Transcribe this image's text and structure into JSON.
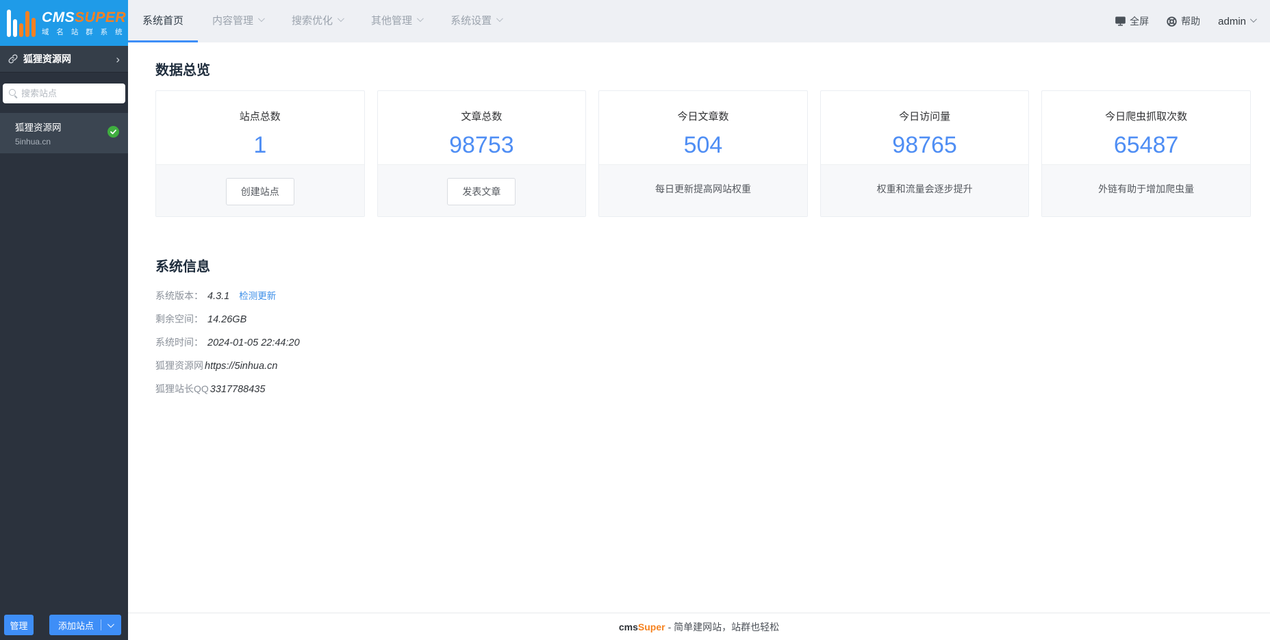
{
  "logo": {
    "brand_cms": "CMS",
    "brand_super": "SUPER",
    "subtitle": "域 名 站 群 系 统"
  },
  "header": {
    "tabs": [
      {
        "label": "系统首页",
        "active": true
      },
      {
        "label": "内容管理",
        "active": false
      },
      {
        "label": "搜索优化",
        "active": false
      },
      {
        "label": "其他管理",
        "active": false
      },
      {
        "label": "系统设置",
        "active": false
      }
    ],
    "actions": {
      "fullscreen": "全屏",
      "help": "帮助",
      "user": "admin"
    }
  },
  "sidebar": {
    "site_group_name": "狐狸资源网",
    "search_placeholder": "搜索站点",
    "sites": [
      {
        "name": "狐狸资源网",
        "domain": "5inhua.cn",
        "active": true
      }
    ],
    "manage_button": "管理",
    "add_site_button": "添加站点"
  },
  "overview": {
    "title": "数据总览",
    "cards": [
      {
        "title": "站点总数",
        "value": "1",
        "action": "创建站点"
      },
      {
        "title": "文章总数",
        "value": "98753",
        "action": "发表文章"
      },
      {
        "title": "今日文章数",
        "value": "504",
        "note": "每日更新提高网站权重"
      },
      {
        "title": "今日访问量",
        "value": "98765",
        "note": "权重和流量会逐步提升"
      },
      {
        "title": "今日爬虫抓取次数",
        "value": "65487",
        "note": "外链有助于增加爬虫量"
      }
    ]
  },
  "system_info": {
    "title": "系统信息",
    "rows": [
      {
        "label": "系统版本：",
        "value": "4.3.1",
        "link": "检测更新"
      },
      {
        "label": "剩余空间：",
        "value": "14.26GB"
      },
      {
        "label": "系统时间：",
        "value": "2024-01-05 22:44:20"
      },
      {
        "label": "狐狸资源网",
        "value": "https://5inhua.cn"
      },
      {
        "label": "狐狸站长QQ",
        "value": "3317788435"
      }
    ]
  },
  "footer": {
    "brand_cms": "cms",
    "brand_super": "Super",
    "text": "- 简单建网站，站群也轻松"
  },
  "colors": {
    "logo_blue": "#1f9be8",
    "brand_orange": "#f78122",
    "accent_blue": "#3e8ef7",
    "value_blue": "#4f8ef4",
    "success_green": "#3fae3f",
    "sidebar_dark": "#2b323d"
  }
}
